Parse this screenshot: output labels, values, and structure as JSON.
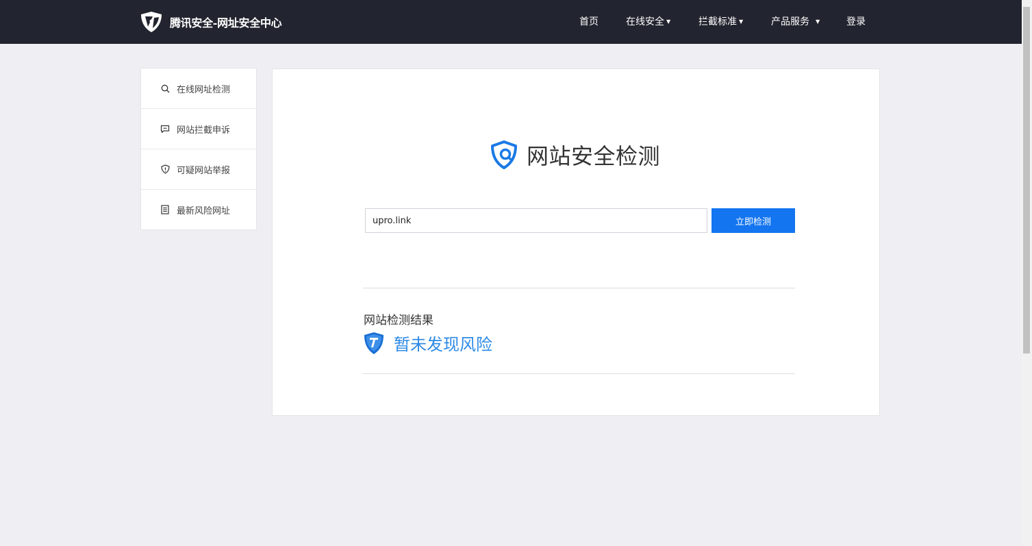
{
  "header": {
    "brand": "腾讯安全-网址安全中心",
    "nav": [
      {
        "label": "首页",
        "caret": ""
      },
      {
        "label": "在线安全",
        "caret": "▼"
      },
      {
        "label": "拦截标准",
        "caret": "▼"
      },
      {
        "label": "产品服务",
        "caret": "▼"
      },
      {
        "label": "登录",
        "caret": ""
      }
    ]
  },
  "sidebar": {
    "items": [
      {
        "label": "在线网址检测",
        "icon": "search-icon"
      },
      {
        "label": "网站拦截申诉",
        "icon": "comment-icon"
      },
      {
        "label": "可疑网站举报",
        "icon": "shield-alert-icon"
      },
      {
        "label": "最新风险网址",
        "icon": "list-icon"
      }
    ]
  },
  "main": {
    "title": "网站安全检测",
    "input_value": "upro.link",
    "button_label": "立即检测",
    "result_label": "网站检测结果",
    "result_text": "暂未发现风险"
  },
  "colors": {
    "header_bg": "#22252f",
    "accent": "#1375ef",
    "result_text": "#2e8ae6",
    "page_bg": "#efeff3"
  }
}
